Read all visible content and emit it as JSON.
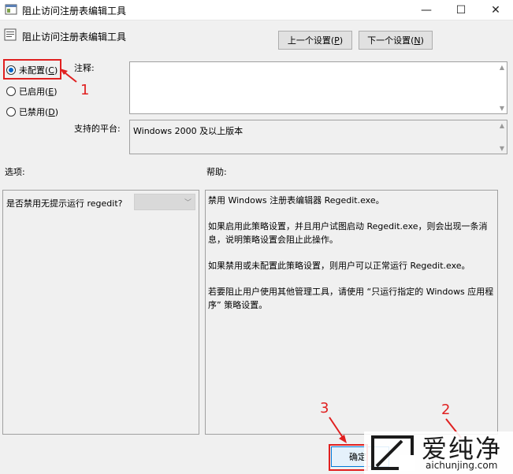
{
  "window": {
    "title": "阻止访问注册表编辑工具",
    "minimize_glyph": "—",
    "maximize_glyph": "☐",
    "close_glyph": "✕"
  },
  "policy": {
    "title": "阻止访问注册表编辑工具",
    "prev_label": "上一个设置(",
    "prev_key": "P",
    "prev_tail": ")",
    "next_label": "下一个设置(",
    "next_key": "N",
    "next_tail": ")"
  },
  "state": {
    "not_configured": "未配置(",
    "not_configured_key": "C",
    "enabled": "已启用(",
    "enabled_key": "E",
    "disabled": "已禁用(",
    "disabled_key": "D",
    "paren_close": ")",
    "selected": "not_configured"
  },
  "comment": {
    "label": "注释:",
    "value": ""
  },
  "platform": {
    "label": "支持的平台:",
    "value": "Windows 2000 及以上版本"
  },
  "options": {
    "label": "选项:",
    "row_text": "是否禁用无提示运行 regedit?",
    "combo_value": ""
  },
  "help": {
    "label": "帮助:",
    "paragraphs": [
      "禁用 Windows 注册表编辑器 Regedit.exe。",
      "如果启用此策略设置，并且用户试图启动 Regedit.exe，则会出现一条消息，说明策略设置会阻止此操作。",
      "如果禁用或未配置此策略设置，则用户可以正常运行 Regedit.exe。",
      "若要阻止用户使用其他管理工具，请使用 “只运行指定的 Windows 应用程序” 策略设置。"
    ]
  },
  "footer": {
    "ok_label": "确定"
  },
  "annotations": {
    "n1": "1",
    "n2": "2",
    "n3": "3",
    "color": "#e02020"
  },
  "watermark": {
    "main": "爱纯净",
    "sub": "aichunjing.com"
  }
}
